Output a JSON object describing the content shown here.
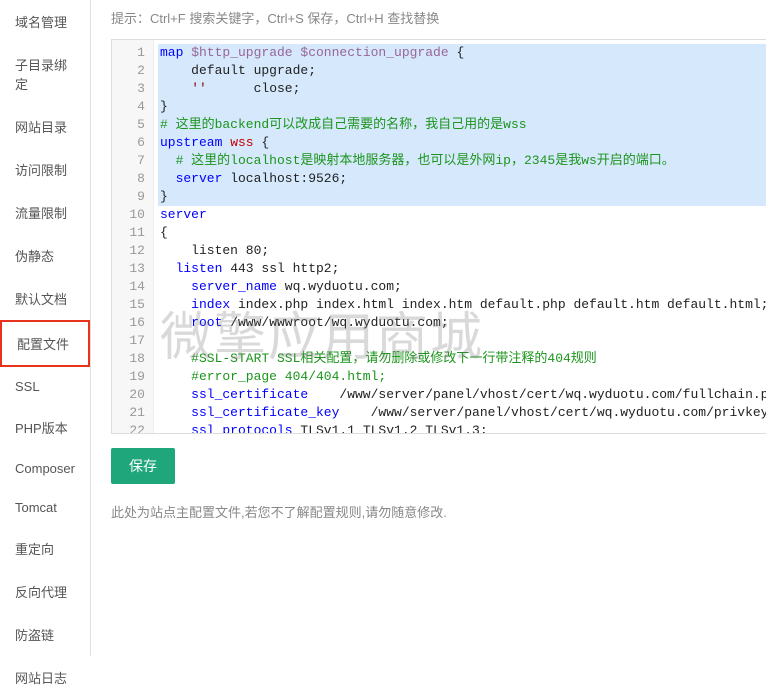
{
  "sidebar": {
    "items": [
      {
        "label": "域名管理"
      },
      {
        "label": "子目录绑定"
      },
      {
        "label": "网站目录"
      },
      {
        "label": "访问限制"
      },
      {
        "label": "流量限制"
      },
      {
        "label": "伪静态"
      },
      {
        "label": "默认文档"
      },
      {
        "label": "配置文件",
        "active": true
      },
      {
        "label": "SSL"
      },
      {
        "label": "PHP版本"
      },
      {
        "label": "Composer"
      },
      {
        "label": "Tomcat"
      },
      {
        "label": "重定向"
      },
      {
        "label": "反向代理"
      },
      {
        "label": "防盗链"
      },
      {
        "label": "网站日志"
      }
    ]
  },
  "hint": "提示：Ctrl+F 搜索关键字，Ctrl+S 保存，Ctrl+H 查找替换",
  "watermark": "微擎应用商城",
  "save_label": "保存",
  "footnote": "此处为站点主配置文件,若您不了解配置规则,请勿随意修改.",
  "code": {
    "lines": [
      {
        "n": 1,
        "sel": true,
        "tokens": [
          {
            "t": "map ",
            "c": "kw"
          },
          {
            "t": "$http_upgrade $connection_upgrade ",
            "c": "var"
          },
          {
            "t": "{",
            "c": "plain"
          }
        ]
      },
      {
        "n": 2,
        "sel": true,
        "tokens": [
          {
            "t": "    default upgrade;",
            "c": "plain"
          }
        ]
      },
      {
        "n": 3,
        "sel": true,
        "tokens": [
          {
            "t": "    ",
            "c": "plain"
          },
          {
            "t": "''",
            "c": "str"
          },
          {
            "t": "      close;",
            "c": "plain"
          }
        ]
      },
      {
        "n": 4,
        "sel": true,
        "tokens": [
          {
            "t": "}",
            "c": "plain"
          }
        ]
      },
      {
        "n": 5,
        "sel": true,
        "tokens": [
          {
            "t": "# 这里的backend可以改成自己需要的名称，我自己用的是wss",
            "c": "cm"
          }
        ]
      },
      {
        "n": 6,
        "sel": true,
        "tokens": [
          {
            "t": "upstream ",
            "c": "kw"
          },
          {
            "t": "wss ",
            "c": "id-red"
          },
          {
            "t": "{",
            "c": "plain"
          }
        ]
      },
      {
        "n": 7,
        "sel": true,
        "tokens": [
          {
            "t": "  # 这里的localhost是映射本地服务器，也可以是外网ip，2345是我ws开启的端口。",
            "c": "cm"
          }
        ]
      },
      {
        "n": 8,
        "sel": true,
        "tokens": [
          {
            "t": "  server ",
            "c": "kw"
          },
          {
            "t": "localhost:9526;",
            "c": "plain"
          }
        ]
      },
      {
        "n": 9,
        "sel": true,
        "tokens": [
          {
            "t": "}",
            "c": "plain"
          }
        ]
      },
      {
        "n": 10,
        "tokens": [
          {
            "t": "server",
            "c": "kw"
          }
        ]
      },
      {
        "n": 11,
        "tokens": [
          {
            "t": "{",
            "c": "plain"
          }
        ]
      },
      {
        "n": 12,
        "tokens": [
          {
            "t": "    listen 80;",
            "c": "plain"
          }
        ]
      },
      {
        "n": 13,
        "tokens": [
          {
            "t": "  listen ",
            "c": "kw"
          },
          {
            "t": "443 ssl http2;",
            "c": "plain"
          }
        ]
      },
      {
        "n": 14,
        "tokens": [
          {
            "t": "    server_name ",
            "c": "kw"
          },
          {
            "t": "wq.wyduotu.com;",
            "c": "plain"
          }
        ]
      },
      {
        "n": 15,
        "tokens": [
          {
            "t": "    index ",
            "c": "kw"
          },
          {
            "t": "index.php index.html index.htm default.php default.htm default.html;",
            "c": "plain"
          }
        ]
      },
      {
        "n": 16,
        "tokens": [
          {
            "t": "    root ",
            "c": "kw"
          },
          {
            "t": "/www/wwwroot/wq.wyduotu.com;",
            "c": "plain"
          }
        ]
      },
      {
        "n": 17,
        "tokens": [
          {
            "t": "    ",
            "c": "plain"
          }
        ]
      },
      {
        "n": 18,
        "tokens": [
          {
            "t": "    #SSL-START SSL相关配置，请勿删除或修改下一行带注释的404规则",
            "c": "cm"
          }
        ]
      },
      {
        "n": 19,
        "tokens": [
          {
            "t": "    #error_page 404/404.html;",
            "c": "cm"
          }
        ]
      },
      {
        "n": 20,
        "tokens": [
          {
            "t": "    ssl_certificate    ",
            "c": "kw"
          },
          {
            "t": "/www/server/panel/vhost/cert/wq.wyduotu.com/fullchain.pem;",
            "c": "plain"
          }
        ]
      },
      {
        "n": 21,
        "tokens": [
          {
            "t": "    ssl_certificate_key    ",
            "c": "kw"
          },
          {
            "t": "/www/server/panel/vhost/cert/wq.wyduotu.com/privkey.pem;",
            "c": "plain"
          }
        ]
      },
      {
        "n": 22,
        "tokens": [
          {
            "t": "    ssl_protocols ",
            "c": "kw"
          },
          {
            "t": "TLSv1.1 TLSv1.2 TLSv1.3;",
            "c": "plain"
          }
        ]
      }
    ]
  }
}
